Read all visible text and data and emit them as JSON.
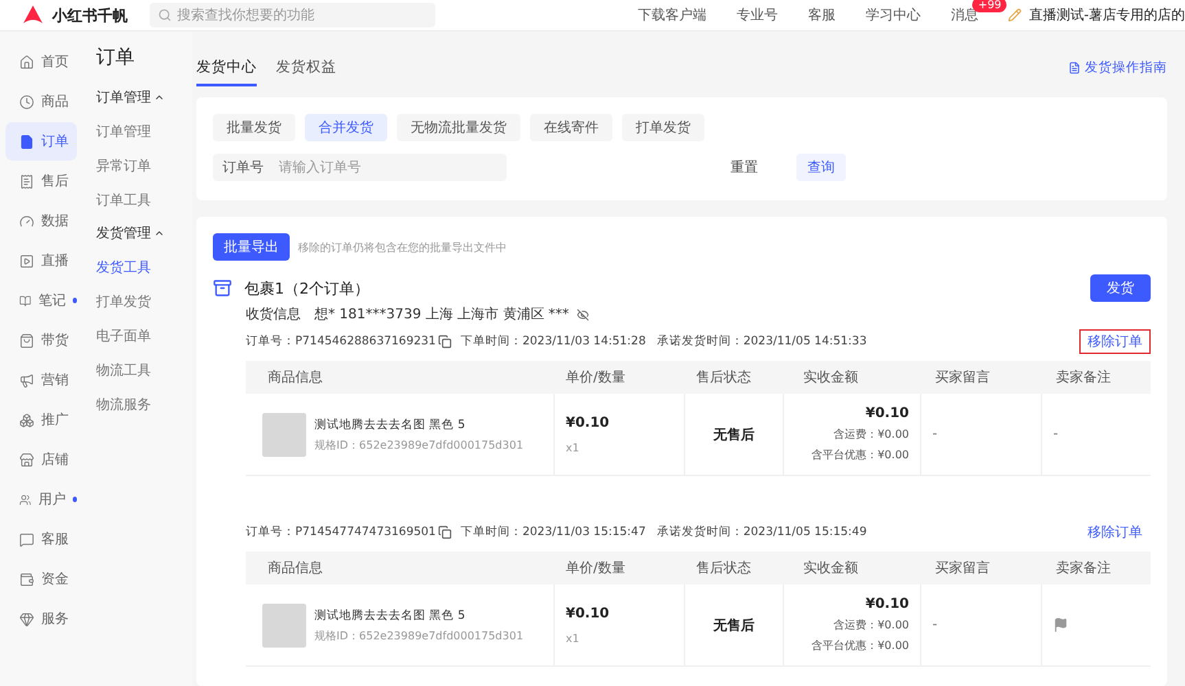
{
  "top_bar": {
    "logo": "小红书千帆",
    "search": {
      "placeholder": "搜索查找你想要的功能"
    },
    "links": [
      "下载客户端",
      "专业号",
      "客服",
      "学习中心"
    ],
    "messages": {
      "label": "消息",
      "badge": "+99"
    },
    "account": "直播测试-薯店专用的店的"
  },
  "sidebar": {
    "items": [
      {
        "label": "首页",
        "selected": false,
        "dot": false
      },
      {
        "label": "商品",
        "selected": false,
        "dot": false
      },
      {
        "label": "订单",
        "selected": true,
        "dot": false
      },
      {
        "label": "售后",
        "selected": false,
        "dot": false
      },
      {
        "label": "数据",
        "selected": false,
        "dot": false
      },
      {
        "label": "直播",
        "selected": false,
        "dot": false
      },
      {
        "label": "笔记",
        "selected": false,
        "dot": true
      },
      {
        "label": "带货",
        "selected": false,
        "dot": false
      },
      {
        "label": "营销",
        "selected": false,
        "dot": false
      },
      {
        "label": "推广",
        "selected": false,
        "dot": false
      },
      {
        "label": "店铺",
        "selected": false,
        "dot": false
      },
      {
        "label": "用户",
        "selected": false,
        "dot": true
      },
      {
        "label": "客服",
        "selected": false,
        "dot": false
      },
      {
        "label": "资金",
        "selected": false,
        "dot": false
      },
      {
        "label": "服务",
        "selected": false,
        "dot": false
      }
    ]
  },
  "subnav": {
    "title": "订单",
    "groups": [
      {
        "label": "订单管理",
        "expanded": true,
        "items": [
          {
            "label": "订单管理",
            "selected": false
          },
          {
            "label": "异常订单",
            "selected": false
          },
          {
            "label": "订单工具",
            "selected": false
          }
        ]
      },
      {
        "label": "发货管理",
        "expanded": true,
        "items": [
          {
            "label": "发货工具",
            "selected": true
          },
          {
            "label": "打单发货",
            "selected": false
          },
          {
            "label": "电子面单",
            "selected": false
          },
          {
            "label": "物流工具",
            "selected": false
          },
          {
            "label": "物流服务",
            "selected": false
          }
        ]
      }
    ]
  },
  "tabs": [
    {
      "label": "发货中心",
      "selected": true
    },
    {
      "label": "发货权益",
      "selected": false
    }
  ],
  "guide_link": "发货操作指南",
  "actions": [
    {
      "label": "批量发货",
      "selected": false
    },
    {
      "label": "合并发货",
      "selected": true
    },
    {
      "label": "无物流批量发货",
      "selected": false
    },
    {
      "label": "在线寄件",
      "selected": false
    },
    {
      "label": "打单发货",
      "selected": false
    }
  ],
  "filter": {
    "label": "订单号",
    "placeholder": "请输入订单号",
    "reset_button": "重置",
    "query_button": "查询"
  },
  "export": {
    "button": "批量导出",
    "note": "移除的订单仍将包含在您的批量导出文件中"
  },
  "package": {
    "title": "包裹1（2个订单）",
    "ship_button": "发货",
    "recipient_label": "收货信息",
    "recipient_value": "想* 181***3739 上海 上海市 黄浦区 ***"
  },
  "orders": [
    {
      "order_no": "订单号：P714546288637169231",
      "order_time": "下单时间：2023/11/03 14:51:28",
      "promise_time": "承诺发货时间：2023/11/05 14:51:33",
      "remove": "移除订单",
      "highlighted": true,
      "columns": [
        "商品信息",
        "单价/数量",
        "售后状态",
        "实收金额",
        "买家留言",
        "卖家备注"
      ],
      "item": {
        "name": "测试地腾去去去名图 黑色 5",
        "spec": "规格ID：652e23989e7dfd000175d301",
        "price": "¥0.10",
        "qty": "x1",
        "after_sale": "无售后",
        "amount": "¥0.10",
        "shipping": "含运费：¥0.00",
        "discount": "含平台优惠：¥0.00",
        "buyer_note": "-",
        "flagged": false,
        "seller_note": "-"
      }
    },
    {
      "order_no": "订单号：P714547747473169501",
      "order_time": "下单时间：2023/11/03 15:15:47",
      "promise_time": "承诺发货时间：2023/11/05 15:15:49",
      "remove": "移除订单",
      "highlighted": false,
      "columns": [
        "商品信息",
        "单价/数量",
        "售后状态",
        "实收金额",
        "买家留言",
        "卖家备注"
      ],
      "item": {
        "name": "测试地腾去去去名图 黑色 5",
        "spec": "规格ID：652e23989e7dfd000175d301",
        "price": "¥0.10",
        "qty": "x1",
        "after_sale": "无售后",
        "amount": "¥0.10",
        "shipping": "含运费：¥0.00",
        "discount": "含平台优惠：¥0.00",
        "buyer_note": "-",
        "flagged": true
      }
    }
  ]
}
